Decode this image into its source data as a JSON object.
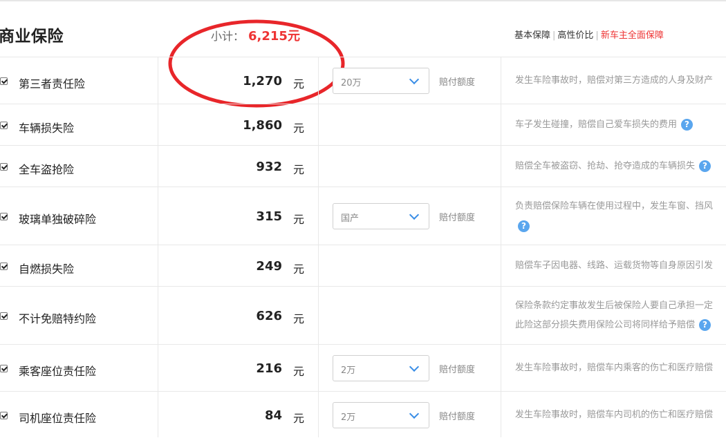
{
  "section": {
    "title": "商业保险",
    "subtotal_label": "小计：",
    "subtotal_value": "6,215元"
  },
  "plans": [
    "基本保障",
    "高性价比",
    "新车主全面保障"
  ],
  "help_glyph": "?",
  "rows": [
    {
      "name": "第三者责任险",
      "amount": "1,270",
      "unit": "元",
      "select": "20万",
      "coverage_label": "赔付额度",
      "desc": "发生车险事故时，赔偿对第三方造成的人身及财产"
    },
    {
      "name": "车辆损失险",
      "amount": "1,860",
      "unit": "元",
      "desc": "车子发生碰撞，赔偿自己爱车损失的费用"
    },
    {
      "name": "全车盗抢险",
      "amount": "932",
      "unit": "元",
      "desc": "赔偿全车被盗窃、抢劫、抢夺造成的车辆损失"
    },
    {
      "name": "玻璃单独破碎险",
      "amount": "315",
      "unit": "元",
      "select": "国产",
      "coverage_label": "赔付额度",
      "desc": "负责赔偿保险车辆在使用过程中，发生车窗、挡风"
    },
    {
      "name": "自燃损失险",
      "amount": "249",
      "unit": "元",
      "desc": "赔偿车子因电器、线路、运载货物等自身原因引发"
    },
    {
      "name": "不计免赔特约险",
      "amount": "626",
      "unit": "元",
      "desc": "保险条款约定事故发生后被保险人要自己承担一定",
      "desc2": "此险这部分损失费用保险公司将同样给予赔偿"
    },
    {
      "name": "乘客座位责任险",
      "amount": "216",
      "unit": "元",
      "select": "2万",
      "coverage_label": "赔付额度",
      "desc": "发生车险事故时，赔偿车内乘客的伤亡和医疗赔偿"
    },
    {
      "name": "司机座位责任险",
      "amount": "84",
      "unit": "元",
      "select": "2万",
      "coverage_label": "赔付额度",
      "desc": "发生车险事故时，赔偿车内司机的伤亡和医疗赔偿"
    }
  ],
  "colors": {
    "accent_red": "#ee3333",
    "help_blue": "#5aa6ee",
    "annotation_red": "#e8262a"
  }
}
